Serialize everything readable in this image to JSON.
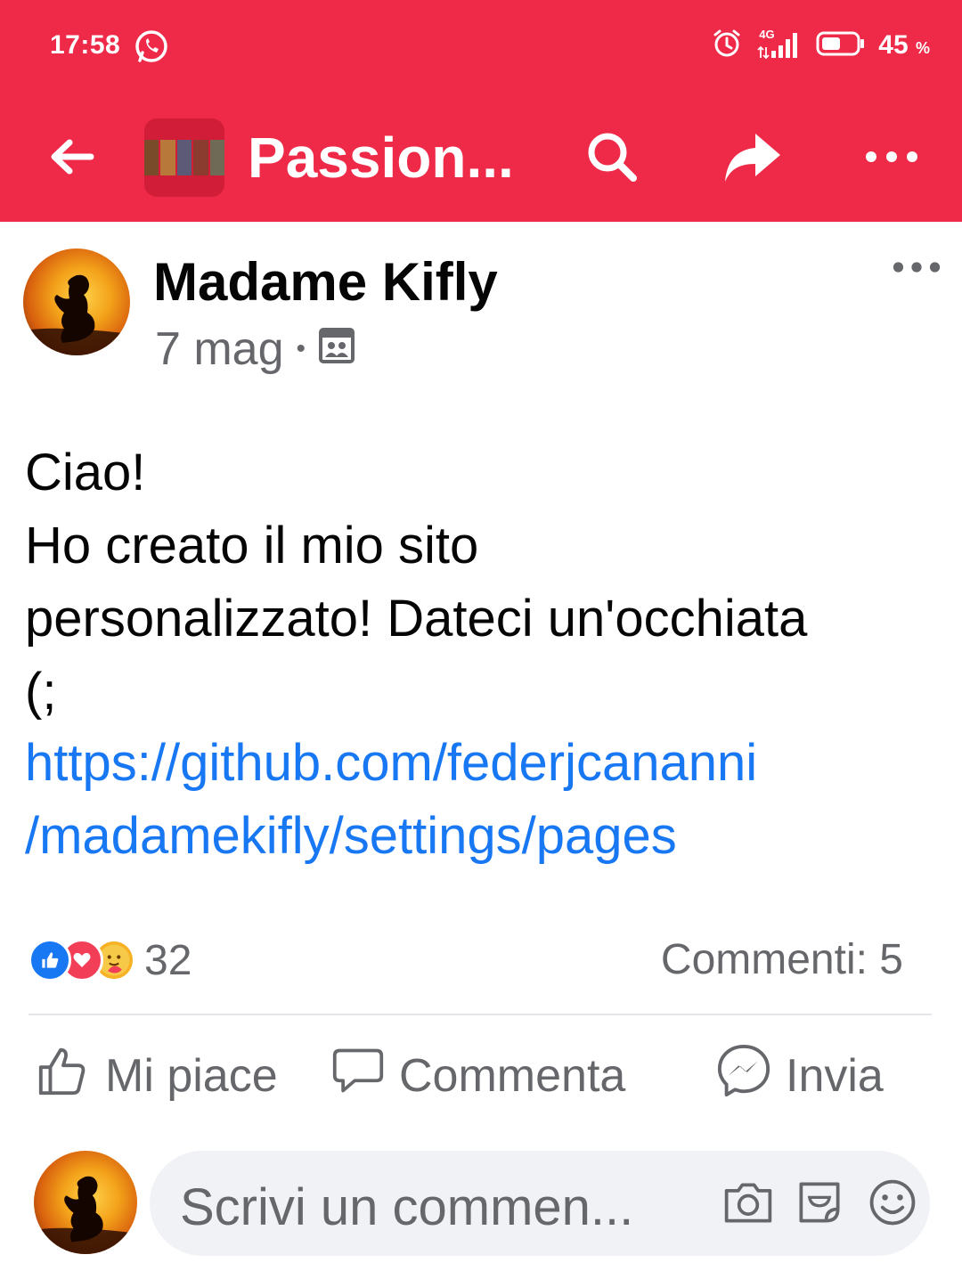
{
  "status_bar": {
    "time": "17:58",
    "network": "4G",
    "battery_percent": "45",
    "battery_unit": "%",
    "icons": [
      "whatsapp-icon",
      "alarm-icon",
      "signal-icon",
      "battery-icon"
    ]
  },
  "header": {
    "title": "Passion...",
    "back_icon": "back-arrow-icon",
    "search_icon": "search-icon",
    "share_icon": "share-icon",
    "more_icon": "more-icon",
    "background_color": "#ee2a48"
  },
  "post": {
    "author": "Madame Kifly",
    "date": "7 mag",
    "separator": "•",
    "audience_icon": "group-audience-icon",
    "text_lines": [
      "Ciao!",
      "Ho creato il mio sito",
      "personalizzato! Dateci un'occhiata",
      "(;"
    ],
    "link_lines": [
      "https://github.com/federjcananni",
      "/madamekifly/settings/pages"
    ],
    "link_color": "#1877f2"
  },
  "reactions": {
    "icons": [
      "like-reaction-icon",
      "love-reaction-icon",
      "care-reaction-icon"
    ],
    "count": "32",
    "comments_label": "Commenti: 5"
  },
  "actions": {
    "like": "Mi piace",
    "comment": "Commenta",
    "send": "Invia"
  },
  "comment_input": {
    "placeholder": "Scrivi un commen...",
    "icons": [
      "camera-icon",
      "gif-sticker-icon",
      "emoji-icon"
    ]
  }
}
